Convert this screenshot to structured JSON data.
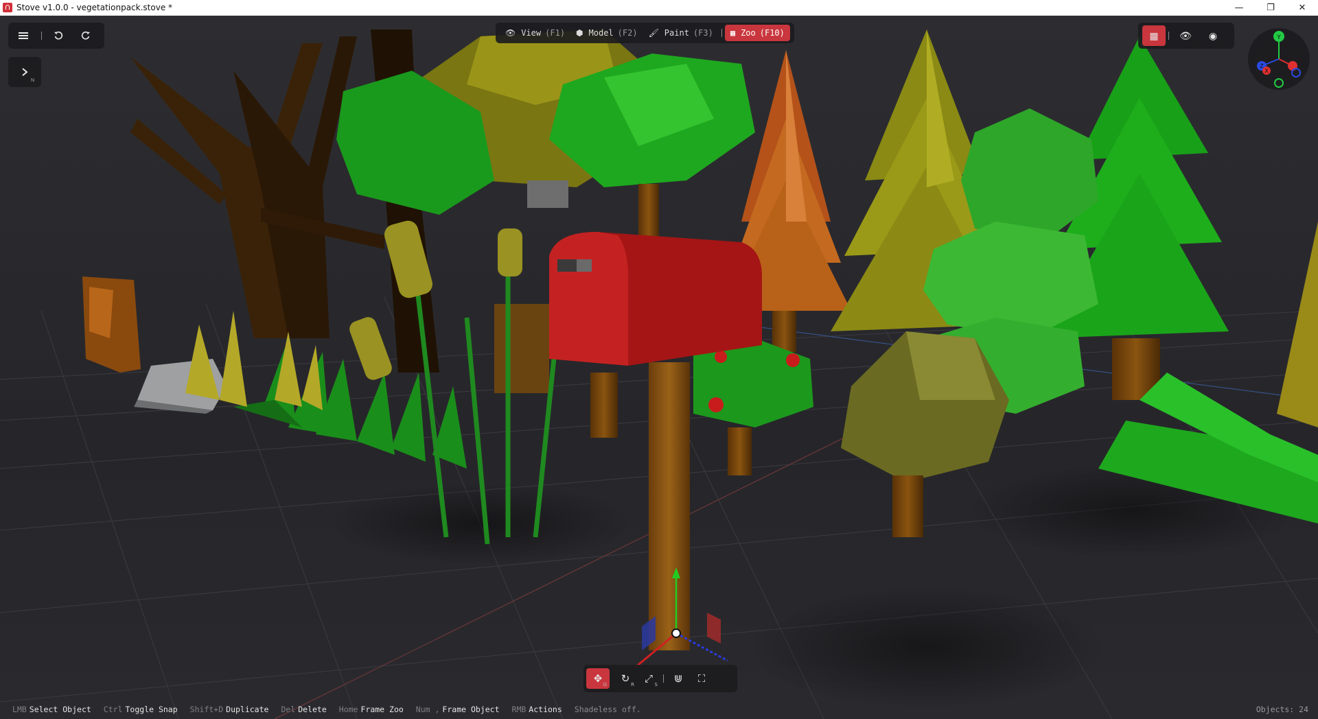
{
  "window": {
    "title": "Stove v1.0.0 - vegetationpack.stove *",
    "minimize_glyph": "—",
    "restore_glyph": "❐",
    "close_glyph": "✕"
  },
  "left_toolbar": {
    "menu_icon": "hamburger-menu-icon",
    "undo_icon": "undo-icon",
    "redo_icon": "redo-icon",
    "expand_icon": "chevron-right-icon",
    "expand_hint": "N"
  },
  "modes": [
    {
      "icon": "eye-icon",
      "label": "View",
      "key": "(F1)"
    },
    {
      "icon": "cube-icon",
      "label": "Model",
      "key": "(F2)"
    },
    {
      "icon": "brush-icon",
      "label": "Paint",
      "key": "(F3)"
    },
    {
      "icon": "grid-icon",
      "label": "Zoo",
      "key": "(F10)",
      "active": true
    }
  ],
  "right_toolbar": {
    "grid_icon": "grid-icon",
    "eye_icon": "eye-icon",
    "globe_icon": "globe-icon"
  },
  "axis_gizmo": {
    "y_label": "Y",
    "z_label": "Z",
    "x_label": "X"
  },
  "transform_tools": [
    {
      "name": "move",
      "icon": "move-icon",
      "hint": "G",
      "active": true
    },
    {
      "name": "rotate",
      "icon": "rotate-icon",
      "hint": "R"
    },
    {
      "name": "scale",
      "icon": "scale-icon",
      "hint": "S"
    },
    {
      "name": "snap",
      "icon": "magnet-icon",
      "hint": ""
    },
    {
      "name": "frame",
      "icon": "frame-icon",
      "hint": ""
    }
  ],
  "status": {
    "hints": [
      {
        "key": "LMB",
        "action": "Select Object"
      },
      {
        "key": "Ctrl",
        "action": "Toggle Snap"
      },
      {
        "key": "Shift+D",
        "action": "Duplicate"
      },
      {
        "key": "Del",
        "action": "Delete"
      },
      {
        "key": "Home",
        "action": "Frame Zoo"
      },
      {
        "key": "Num ,",
        "action": "Frame Object"
      },
      {
        "key": "RMB",
        "action": "Actions"
      },
      {
        "key": "",
        "action": "Shadeless off."
      }
    ],
    "objects": "Objects: 24"
  },
  "colors": {
    "accent": "#c9363d",
    "panel": "#1c1c1f",
    "viewport": "#27272b"
  }
}
